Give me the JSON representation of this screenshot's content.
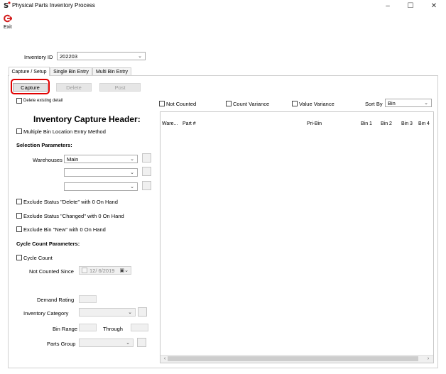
{
  "window": {
    "title": "Physical Parts Inventory Process",
    "minimize": "–",
    "maximize": "☐",
    "close": "✕"
  },
  "toolbar": {
    "exit_label": "Exit",
    "exit_icon": "exit-icon"
  },
  "inventory": {
    "label": "Inventory ID",
    "value": "202203"
  },
  "tabs": [
    "Capture / Setup",
    "Single Bin Entry",
    "Multi Bin Entry"
  ],
  "actions": {
    "capture": "Capture",
    "delete": "Delete",
    "post": "Post"
  },
  "delete_existing": "Delete existing detail",
  "header_title": "Inventory Capture Header:",
  "multiple_bin": "Multiple Bin Location Entry Method",
  "selection": {
    "title": "Selection Parameters:",
    "warehouses_label": "Warehouses",
    "warehouse_value": "Main",
    "exclude_delete": "Exclude Status \"Delete\" with 0 On Hand",
    "exclude_changed": "Exclude Status \"Changed\" with 0 On Hand",
    "exclude_bin_new": "Exclude Bin \"New\" with 0 On Hand"
  },
  "cycle": {
    "title": "Cycle Count Parameters:",
    "cycle_count": "Cycle Count",
    "not_counted_since_label": "Not Counted Since",
    "not_counted_since_value": "12/ 6/2019",
    "demand_rating": "Demand Rating",
    "inventory_category": "Inventory Category",
    "bin_range": "Bin Range",
    "through": "Through",
    "parts_group": "Parts Group"
  },
  "filters": {
    "not_counted": "Not Counted",
    "count_variance": "Count Variance",
    "value_variance": "Value Variance",
    "sort_by_label": "Sort By",
    "sort_by_value": "Bin"
  },
  "grid": {
    "columns": [
      "Ware...",
      "Part #",
      "Pri-Bin",
      "Bin 1",
      "Bin 2",
      "Bin 3",
      "Bin 4"
    ]
  }
}
